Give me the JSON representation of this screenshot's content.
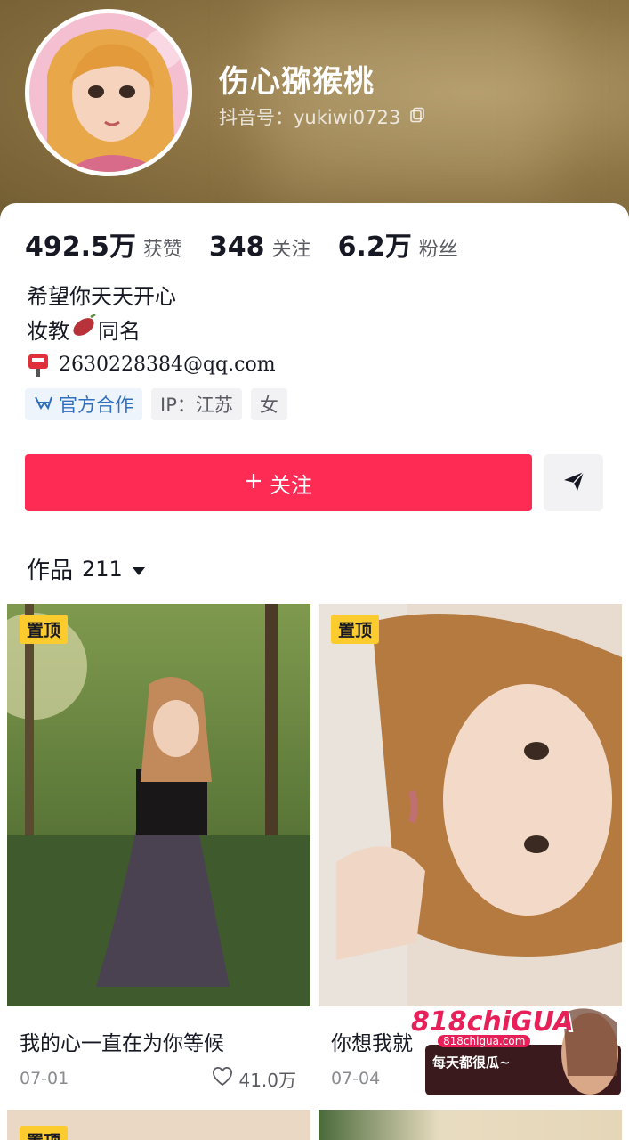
{
  "profile": {
    "name": "伤心猕猴桃",
    "douyin_id": "抖音号：yukiwi0723"
  },
  "stats": [
    {
      "value": "492.5万",
      "label": "获赞"
    },
    {
      "value": "348",
      "label": "关注"
    },
    {
      "value": "6.2万",
      "label": "粉丝"
    }
  ],
  "bio": {
    "line1": "希望你天天开心",
    "line2_prefix": "妆教",
    "line2_suffix": "同名",
    "email": "2630228384@qq.com"
  },
  "tags": {
    "official": "官方合作",
    "ip": "IP：江苏",
    "gender": "女"
  },
  "actions": {
    "follow_label": "关注"
  },
  "works": {
    "label": "作品",
    "count": "211"
  },
  "videos": [
    {
      "pin": "置顶",
      "title": "我的心一直在为你等候",
      "date": "07-01",
      "likes": "41.0万"
    },
    {
      "pin": "置顶",
      "title": "你想我就",
      "date": "07-04",
      "likes": ""
    }
  ],
  "bottom_row": {
    "pin": "置顶"
  },
  "ad": {
    "brand": "818chiGUA",
    "site": "818chigua.com",
    "slogan": "每天都很瓜~"
  },
  "colors": {
    "accent": "#fe2c55",
    "pin": "#fccb2e",
    "official": "#2f6fc0"
  }
}
